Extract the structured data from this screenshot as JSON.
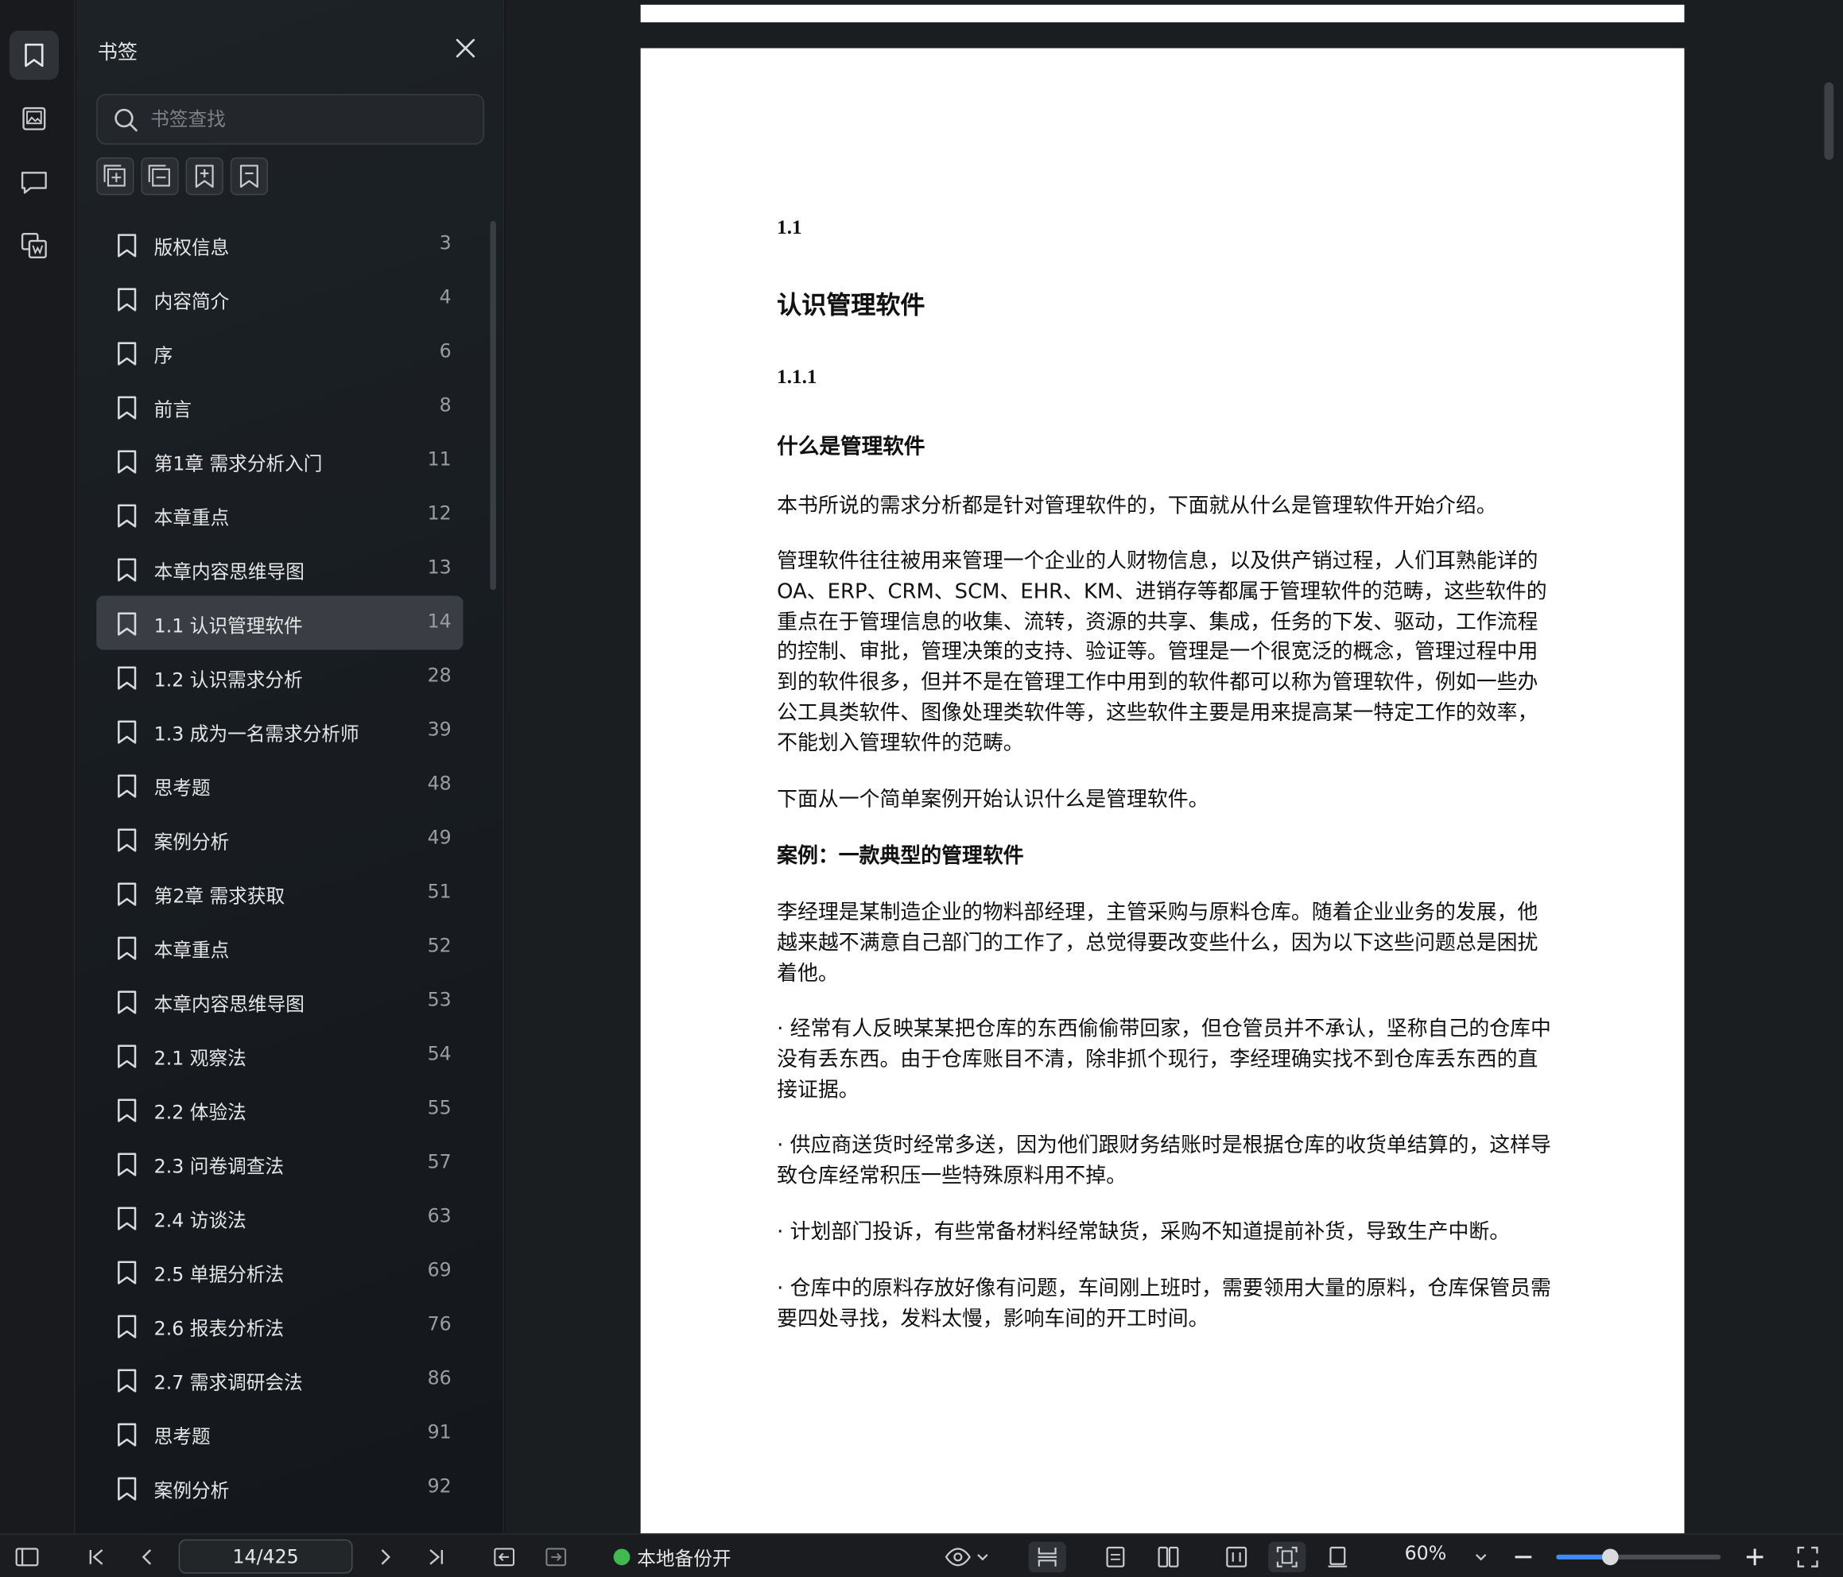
{
  "rail": {
    "items": [
      "bookmark-icon",
      "image-icon",
      "comment-icon",
      "ocr-icon"
    ]
  },
  "panel": {
    "title": "书签",
    "search_placeholder": "书签查找",
    "bookmarks": [
      {
        "label": "版权信息",
        "page": "3"
      },
      {
        "label": "内容简介",
        "page": "4"
      },
      {
        "label": "序",
        "page": "6"
      },
      {
        "label": "前言",
        "page": "8"
      },
      {
        "label": "第1章 需求分析入门",
        "page": "11"
      },
      {
        "label": "本章重点",
        "page": "12"
      },
      {
        "label": "本章内容思维导图",
        "page": "13"
      },
      {
        "label": "1.1 认识管理软件",
        "page": "14",
        "active": true
      },
      {
        "label": "1.2 认识需求分析",
        "page": "28"
      },
      {
        "label": "1.3 成为一名需求分析师",
        "page": "39"
      },
      {
        "label": "思考题",
        "page": "48"
      },
      {
        "label": "案例分析",
        "page": "49"
      },
      {
        "label": "第2章 需求获取",
        "page": "51"
      },
      {
        "label": "本章重点",
        "page": "52"
      },
      {
        "label": "本章内容思维导图",
        "page": "53"
      },
      {
        "label": "2.1 观察法",
        "page": "54"
      },
      {
        "label": "2.2 体验法",
        "page": "55"
      },
      {
        "label": "2.3 问卷调查法",
        "page": "57"
      },
      {
        "label": "2.4 访谈法",
        "page": "63"
      },
      {
        "label": "2.5 单据分析法",
        "page": "69"
      },
      {
        "label": "2.6 报表分析法",
        "page": "76"
      },
      {
        "label": "2.7 需求调研会法",
        "page": "86"
      },
      {
        "label": "思考题",
        "page": "91"
      },
      {
        "label": "案例分析",
        "page": "92"
      }
    ]
  },
  "document": {
    "section_num": "1.1",
    "section_title": "认识管理软件",
    "subsection_num": "1.1.1",
    "subsection_title": "什么是管理软件",
    "p1": "本书所说的需求分析都是针对管理软件的，下面就从什么是管理软件开始介绍。",
    "p2": "管理软件往往被用来管理一个企业的人财物信息，以及供产销过程，人们耳熟能详的OA、ERP、CRM、SCM、EHR、KM、进销存等都属于管理软件的范畴，这些软件的重点在于管理信息的收集、流转，资源的共享、集成，任务的下发、驱动，工作流程的控制、审批，管理决策的支持、验证等。管理是一个很宽泛的概念，管理过程中用到的软件很多，但并不是在管理工作中用到的软件都可以称为管理软件，例如一些办公工具类软件、图像处理类软件等，这些软件主要是用来提高某一特定工作的效率，不能划入管理软件的范畴。",
    "p3": "下面从一个简单案例开始认识什么是管理软件。",
    "case_title": "案例：一款典型的管理软件",
    "p4": "李经理是某制造企业的物料部经理，主管采购与原料仓库。随着企业业务的发展，他越来越不满意自己部门的工作了，总觉得要改变些什么，因为以下这些问题总是困扰着他。",
    "b1": "· 经常有人反映某某把仓库的东西偷偷带回家，但仓管员并不承认，坚称自己的仓库中没有丢东西。由于仓库账目不清，除非抓个现行，李经理确实找不到仓库丢东西的直接证据。",
    "b2": "· 供应商送货时经常多送，因为他们跟财务结账时是根据仓库的收货单结算的，这样导致仓库经常积压一些特殊原料用不掉。",
    "b3": "· 计划部门投诉，有些常备材料经常缺货，采购不知道提前补货，导致生产中断。",
    "b4": "· 仓库中的原料存放好像有问题，车间刚上班时，需要领用大量的原料，仓库保管员需要四处寻找，发料太慢，影响车间的开工时间。"
  },
  "bottom_bar": {
    "page_value": "14/425",
    "backup_label": "本地备份开",
    "zoom": "60%",
    "zoom_fraction": 0.33
  },
  "colors": {
    "accent": "#3d8bfd",
    "backup_dot": "#3fb950",
    "panel_bg": "#1b2024",
    "page_bg": "#ffffff"
  }
}
